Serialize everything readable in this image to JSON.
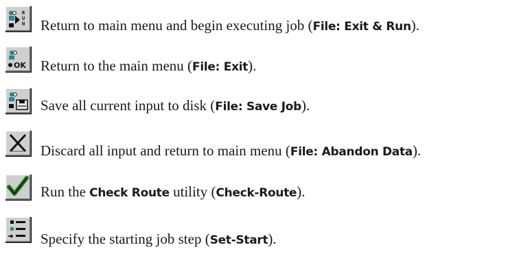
{
  "toolbar_reference": [
    {
      "icon": "exit-and-run-icon",
      "text_before": "Return to main menu and begin executing job (",
      "command": "File: Exit & Run",
      "text_after": ")."
    },
    {
      "icon": "exit-ok-icon",
      "icon_label": "OK",
      "text_before": "Return to the main menu (",
      "command": "File: Exit",
      "text_after": ")."
    },
    {
      "icon": "save-job-icon",
      "text_before": "Save all current input to disk (",
      "command": "File: Save Job",
      "text_after": ")."
    },
    {
      "icon": "abandon-data-icon",
      "text_before": "Discard all input and return to main menu (",
      "command": "File: Abandon Data",
      "text_after": ")."
    },
    {
      "icon": "check-route-icon",
      "text_before": "Run the ",
      "utility": "Check Route",
      "text_middle": " utility (",
      "command": "Check-Route",
      "text_after": ")."
    },
    {
      "icon": "set-start-icon",
      "text_before": "Specify the starting job step (",
      "command": "Set-Start",
      "text_after": ")."
    }
  ],
  "colors": {
    "button_face": "#cfcfcf",
    "icon_dark": "#111111",
    "icon_teal": "#2a8a8a",
    "check_green": "#1f7a1f"
  }
}
